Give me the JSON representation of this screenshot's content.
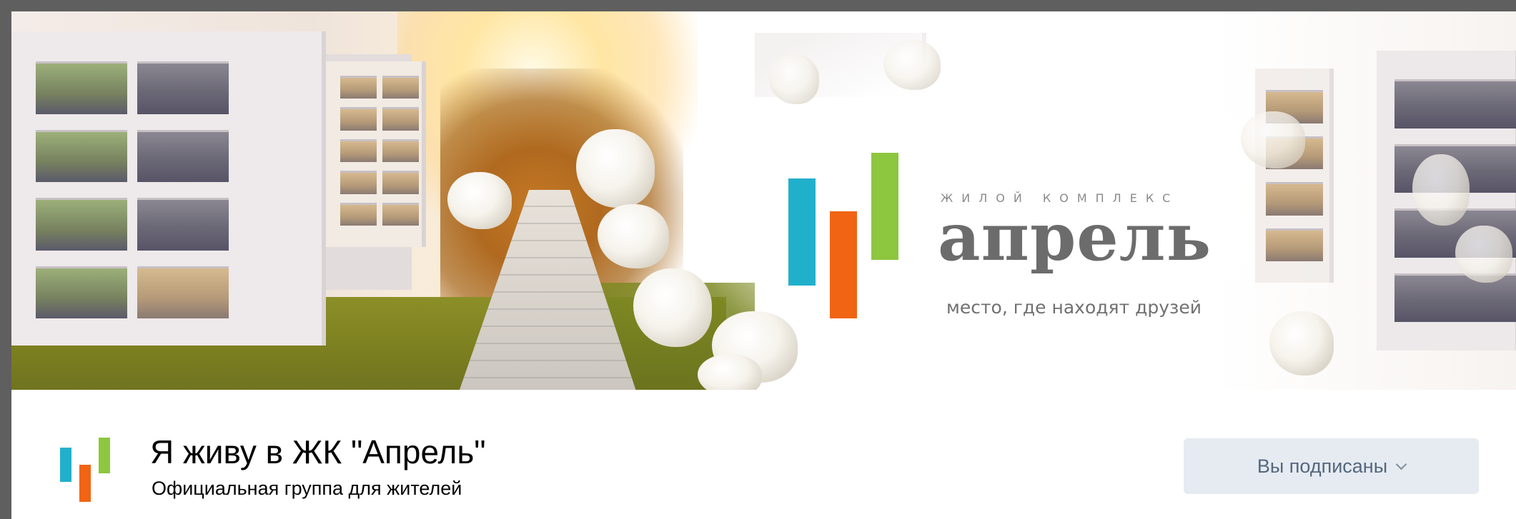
{
  "cover": {
    "logo_subtitle": "ЖИЛОЙ КОМПЛЕКС",
    "logo_name": "апрель",
    "tagline": "место, где находят друзей"
  },
  "group": {
    "title": "Я живу в ЖК \"Апрель\"",
    "subtitle": "Официальная группа для жителей"
  },
  "actions": {
    "subscribed_label": "Вы подписаны"
  },
  "colors": {
    "logo_blue": "#21b0cc",
    "logo_orange": "#f06414",
    "logo_green": "#8dc63f",
    "button_bg": "#e5ebf1",
    "button_text": "#55677d"
  },
  "icons": {
    "dropdown": "chevron-down-icon"
  }
}
